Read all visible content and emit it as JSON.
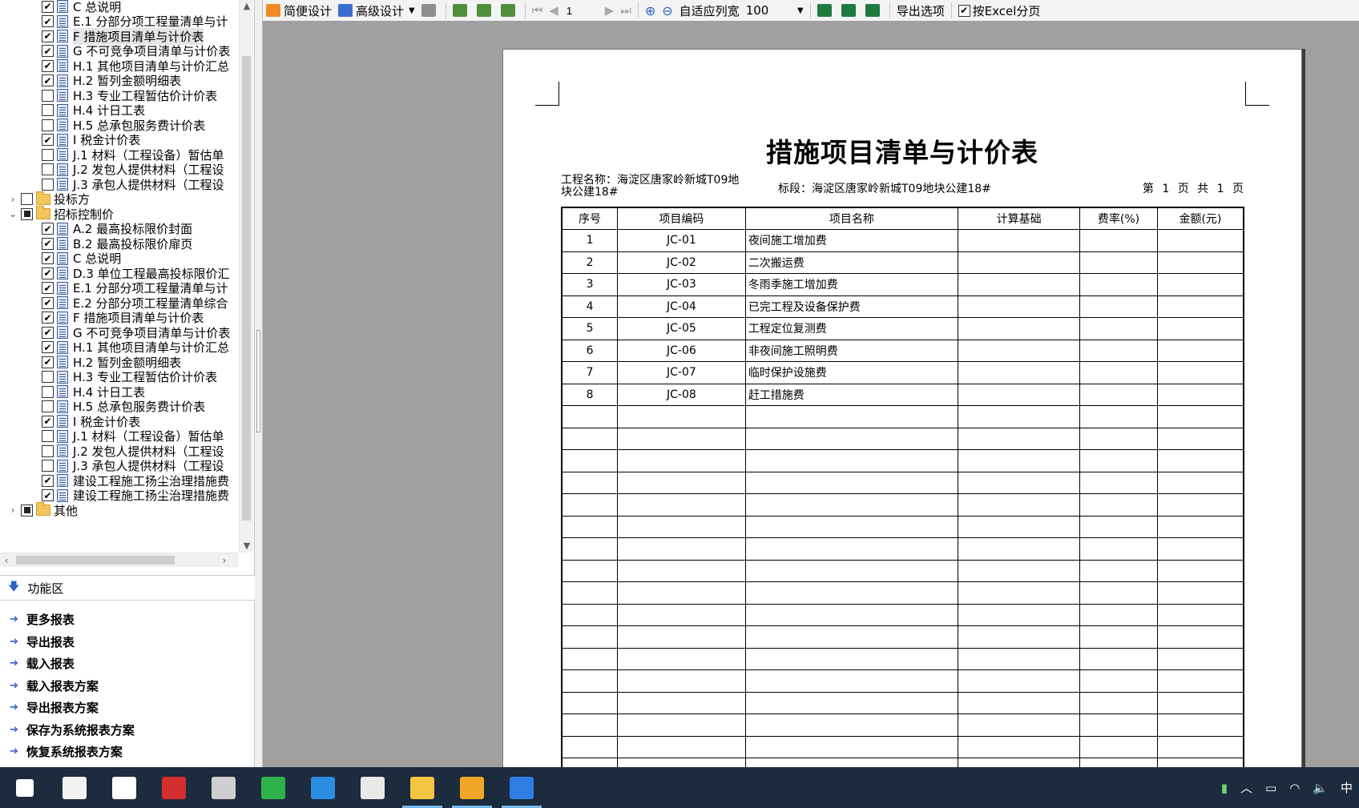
{
  "tree": {
    "items": [
      {
        "label": "C 总说明",
        "checked": "checked",
        "type": "report",
        "indent": 2
      },
      {
        "label": "E.1 分部分项工程量清单与计",
        "checked": "checked",
        "type": "report",
        "indent": 2
      },
      {
        "label": "F 措施项目清单与计价表",
        "checked": "checked",
        "type": "report",
        "indent": 2,
        "selected": true
      },
      {
        "label": "G 不可竞争项目清单与计价表",
        "checked": "checked",
        "type": "report",
        "indent": 2
      },
      {
        "label": "H.1 其他项目清单与计价汇总",
        "checked": "checked",
        "type": "report",
        "indent": 2
      },
      {
        "label": "H.2 暂列金额明细表",
        "checked": "checked",
        "type": "report",
        "indent": 2
      },
      {
        "label": "H.3 专业工程暂估价计价表",
        "checked": "",
        "type": "report",
        "indent": 2
      },
      {
        "label": "H.4 计日工表",
        "checked": "",
        "type": "report",
        "indent": 2
      },
      {
        "label": "H.5 总承包服务费计价表",
        "checked": "",
        "type": "report",
        "indent": 2
      },
      {
        "label": "I 税金计价表",
        "checked": "checked",
        "type": "report",
        "indent": 2
      },
      {
        "label": "J.1 材料（工程设备）暂估单",
        "checked": "",
        "type": "report",
        "indent": 2
      },
      {
        "label": "J.2 发包人提供材料（工程设",
        "checked": "",
        "type": "report",
        "indent": 2
      },
      {
        "label": "J.3 承包人提供材料（工程设",
        "checked": "",
        "type": "report",
        "indent": 2
      },
      {
        "label": "投标方",
        "checked": "",
        "type": "folder",
        "indent": 1,
        "expander": "›"
      },
      {
        "label": "招标控制价",
        "checked": "partial",
        "type": "folder",
        "indent": 1,
        "expander": "⌄"
      },
      {
        "label": "A.2 最高投标限价封面",
        "checked": "checked",
        "type": "report",
        "indent": 2
      },
      {
        "label": "B.2 最高投标限价扉页",
        "checked": "checked",
        "type": "report",
        "indent": 2
      },
      {
        "label": "C 总说明",
        "checked": "checked",
        "type": "report",
        "indent": 2
      },
      {
        "label": "D.3 单位工程最高投标限价汇",
        "checked": "checked",
        "type": "report",
        "indent": 2
      },
      {
        "label": "E.1 分部分项工程量清单与计",
        "checked": "checked",
        "type": "report",
        "indent": 2
      },
      {
        "label": "E.2 分部分项工程量清单综合",
        "checked": "checked",
        "type": "report",
        "indent": 2
      },
      {
        "label": "F 措施项目清单与计价表",
        "checked": "checked",
        "type": "report",
        "indent": 2
      },
      {
        "label": "G 不可竞争项目清单与计价表",
        "checked": "checked",
        "type": "report",
        "indent": 2
      },
      {
        "label": "H.1 其他项目清单与计价汇总",
        "checked": "checked",
        "type": "report",
        "indent": 2
      },
      {
        "label": "H.2 暂列金额明细表",
        "checked": "checked",
        "type": "report",
        "indent": 2
      },
      {
        "label": "H.3 专业工程暂估价计价表",
        "checked": "",
        "type": "report",
        "indent": 2
      },
      {
        "label": "H.4 计日工表",
        "checked": "",
        "type": "report",
        "indent": 2
      },
      {
        "label": "H.5 总承包服务费计价表",
        "checked": "",
        "type": "report",
        "indent": 2
      },
      {
        "label": "I 税金计价表",
        "checked": "checked",
        "type": "report",
        "indent": 2
      },
      {
        "label": "J.1 材料（工程设备）暂估单",
        "checked": "",
        "type": "report",
        "indent": 2
      },
      {
        "label": "J.2 发包人提供材料（工程设",
        "checked": "",
        "type": "report",
        "indent": 2
      },
      {
        "label": "J.3 承包人提供材料（工程设",
        "checked": "",
        "type": "report",
        "indent": 2
      },
      {
        "label": "建设工程施工扬尘治理措施费",
        "checked": "checked",
        "type": "report",
        "indent": 2
      },
      {
        "label": "建设工程施工扬尘治理措施费",
        "checked": "checked",
        "type": "report",
        "indent": 2
      },
      {
        "label": "其他",
        "checked": "partial",
        "type": "folder",
        "indent": 1,
        "expander": "›"
      }
    ]
  },
  "func_panel": {
    "title": "功能区",
    "items": [
      "更多报表",
      "导出报表",
      "载入报表",
      "载入报表方案",
      "导出报表方案",
      "保存为系统报表方案",
      "恢复系统报表方案"
    ]
  },
  "toolbar": {
    "simple_design": "简便设计",
    "advanced_design": "高级设计",
    "page_number": "1",
    "fit_width": "自适应列宽",
    "zoom": "100",
    "export_options": "导出选项",
    "excel_paging": "按Excel分页"
  },
  "report": {
    "title": "措施项目清单与计价表",
    "project_name": "工程名称：海淀区唐家岭新城T09地块公建18#",
    "section": "标段：海淀区唐家岭新城T09地块公建18#",
    "page_info": "第 1 页 共 1 页",
    "headers": [
      "序号",
      "项目编码",
      "项目名称",
      "计算基础",
      "费率(%)",
      "金额(元)"
    ],
    "rows": [
      [
        "1",
        "JC-01",
        "夜间施工增加费",
        "",
        "",
        ""
      ],
      [
        "2",
        "JC-02",
        "二次搬运费",
        "",
        "",
        ""
      ],
      [
        "3",
        "JC-03",
        "冬雨季施工增加费",
        "",
        "",
        ""
      ],
      [
        "4",
        "JC-04",
        "已完工程及设备保护费",
        "",
        "",
        ""
      ],
      [
        "5",
        "JC-05",
        "工程定位复测费",
        "",
        "",
        ""
      ],
      [
        "6",
        "JC-06",
        "非夜间施工照明费",
        "",
        "",
        ""
      ],
      [
        "7",
        "JC-07",
        "临时保护设施费",
        "",
        "",
        ""
      ],
      [
        "8",
        "JC-08",
        "赶工措施费",
        "",
        "",
        ""
      ]
    ],
    "empty_rows": 17
  },
  "taskbar": {
    "apps": [
      {
        "name": "start-icon",
        "color": "#ffffff"
      },
      {
        "name": "store-icon",
        "color": "#f2f2f2"
      },
      {
        "name": "mail-icon",
        "color": "#ffffff"
      },
      {
        "name": "pdf-icon",
        "color": "#d32f2f"
      },
      {
        "name": "video-icon",
        "color": "#cfcfcf"
      },
      {
        "name": "green-app-icon",
        "color": "#2fb14a"
      },
      {
        "name": "edge-icon",
        "color": "#2b8de0"
      },
      {
        "name": "x-app-icon",
        "color": "#e9e9e9"
      },
      {
        "name": "explorer-icon",
        "color": "#f4c542"
      },
      {
        "name": "notes-app-icon",
        "color": "#f0a629"
      },
      {
        "name": "wps-icon",
        "color": "#2e7de3"
      }
    ],
    "tray_text": "中"
  }
}
